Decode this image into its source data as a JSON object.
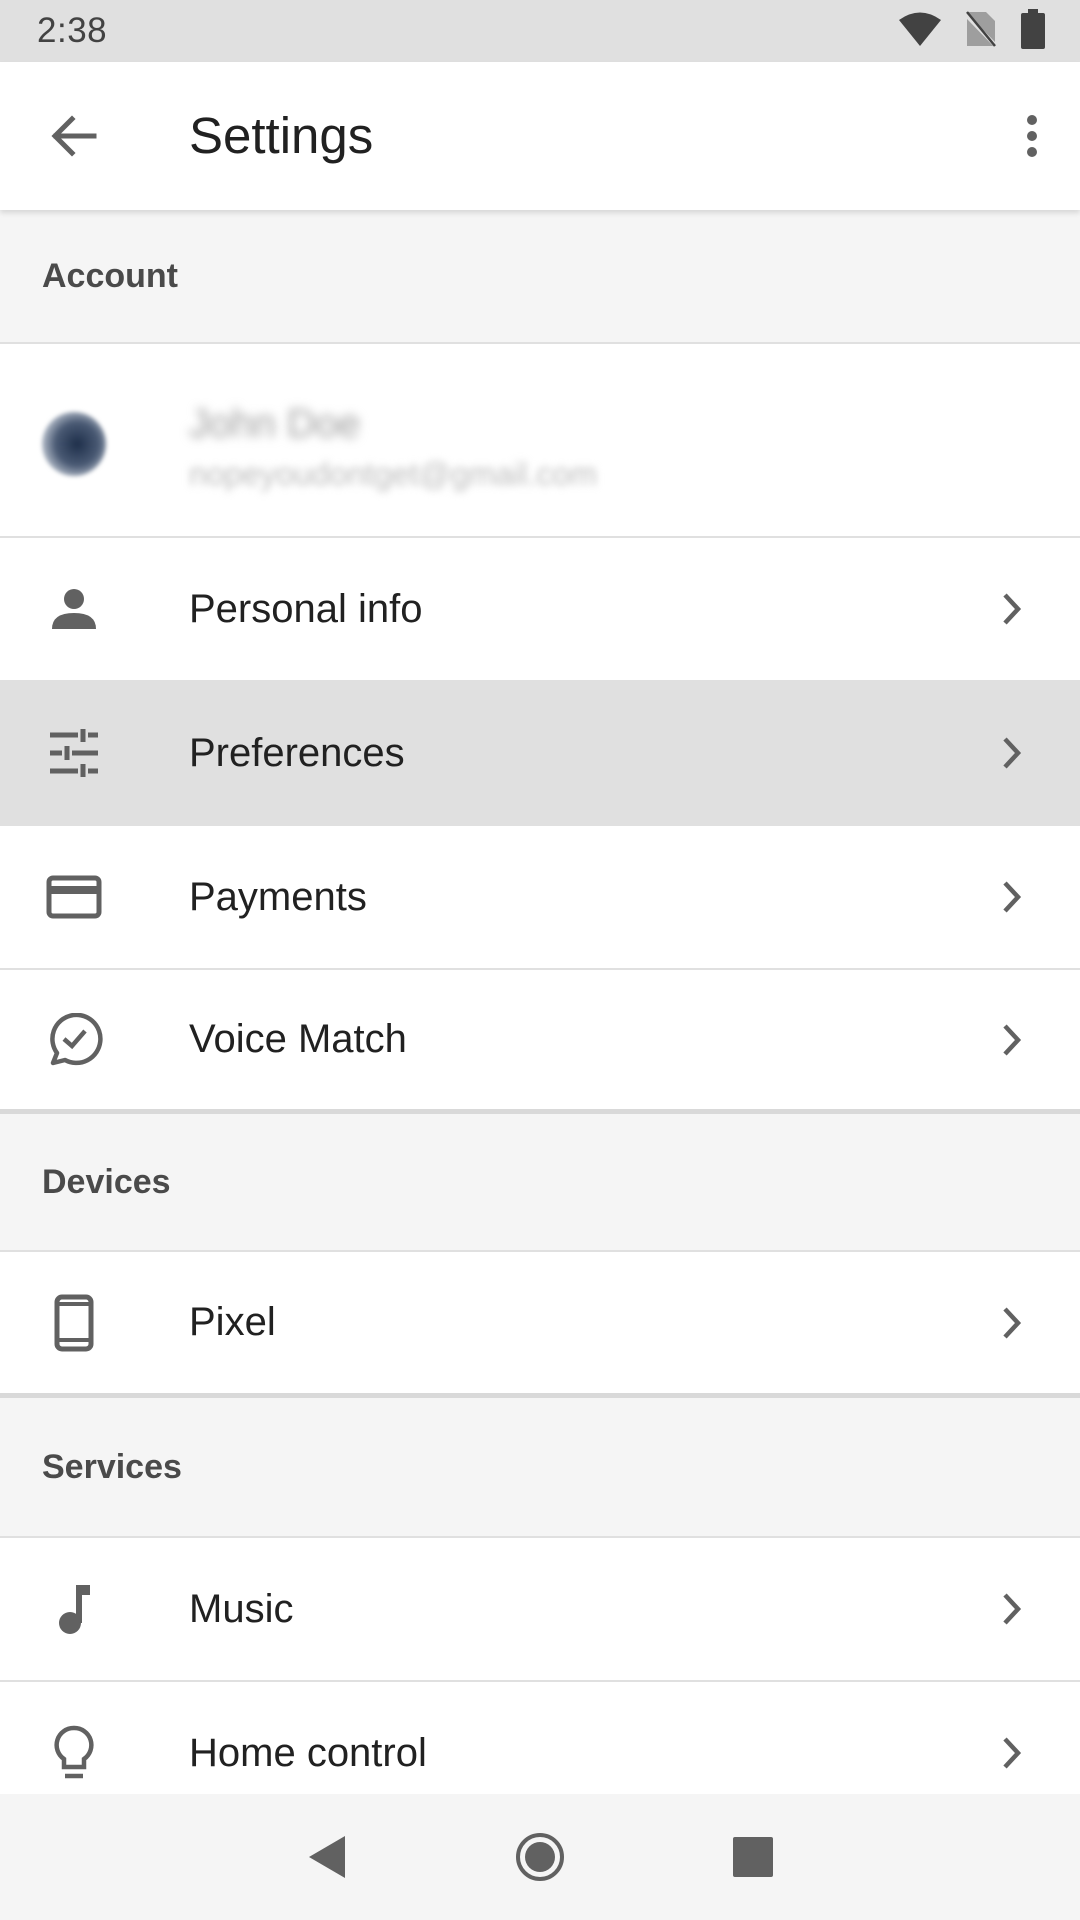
{
  "status_bar": {
    "time": "2:38",
    "icons": [
      "wifi-icon",
      "no-sim-icon",
      "battery-icon"
    ]
  },
  "app_bar": {
    "title": "Settings",
    "back_icon": "arrow-back-icon",
    "overflow_icon": "more-vert-icon"
  },
  "sections": {
    "account": {
      "header": "Account",
      "user_name": "John Doe",
      "user_email": "nopeyoudontget@gmail.com",
      "items": [
        {
          "label": "Personal info",
          "icon": "person-icon"
        },
        {
          "label": "Preferences",
          "icon": "tune-icon",
          "highlighted": true
        },
        {
          "label": "Payments",
          "icon": "credit-card-icon"
        },
        {
          "label": "Voice Match",
          "icon": "voice-match-icon"
        }
      ]
    },
    "devices": {
      "header": "Devices",
      "items": [
        {
          "label": "Pixel",
          "icon": "phone-icon"
        }
      ]
    },
    "services": {
      "header": "Services",
      "items": [
        {
          "label": "Music",
          "icon": "music-note-icon"
        },
        {
          "label": "Home control",
          "icon": "lightbulb-icon"
        }
      ]
    }
  },
  "nav_bar": {
    "buttons": [
      "nav-back-icon",
      "nav-home-icon",
      "nav-recents-icon"
    ]
  },
  "colors": {
    "status_bar_bg": "#e0e0e0",
    "section_bg": "#f5f5f5",
    "highlight_bg": "#e0e0e0",
    "icon_gray": "#616161",
    "text_primary": "#212121"
  }
}
